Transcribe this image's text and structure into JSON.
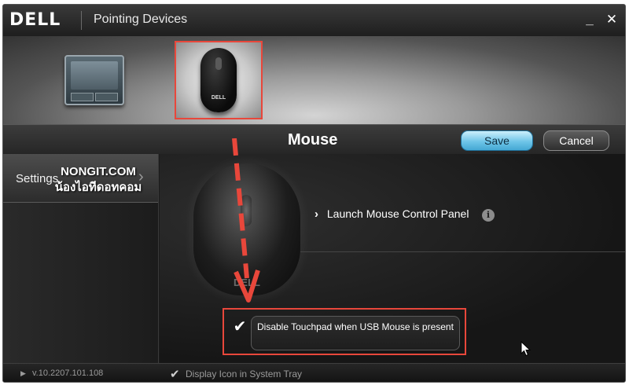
{
  "window": {
    "brand": "DELL",
    "title": "Pointing Devices",
    "minimize_symbol": "_",
    "close_symbol": "✕"
  },
  "devices": [
    {
      "name": "touchpad",
      "icon": "touchpad-icon",
      "selected": false
    },
    {
      "name": "mouse",
      "icon": "mouse-icon",
      "selected": true,
      "brand_text": "DELL"
    }
  ],
  "header": {
    "title": "Mouse",
    "save_label": "Save",
    "cancel_label": "Cancel"
  },
  "sidebar": {
    "items": [
      {
        "label": "Settings",
        "chevron": "›"
      }
    ],
    "watermark_line1": "NONGIT.COM",
    "watermark_line2": "น้องไอทีดอทคอม"
  },
  "main": {
    "mouse_brand": "DELL",
    "launch_arrow": "›",
    "launch_label": "Launch Mouse Control Panel",
    "info_symbol": "i",
    "setting": {
      "checked": true,
      "check_symbol": "✔",
      "label": "Disable Touchpad when USB Mouse is present"
    }
  },
  "footer": {
    "version_triangle": "▶",
    "version": "v.10.2207.101.108",
    "tray_check_symbol": "✔",
    "tray_label": "Display Icon in System Tray"
  },
  "colors": {
    "highlight_red": "#e8473b",
    "save_blue": "#6fc5e8",
    "background": "#1b1b1b"
  }
}
